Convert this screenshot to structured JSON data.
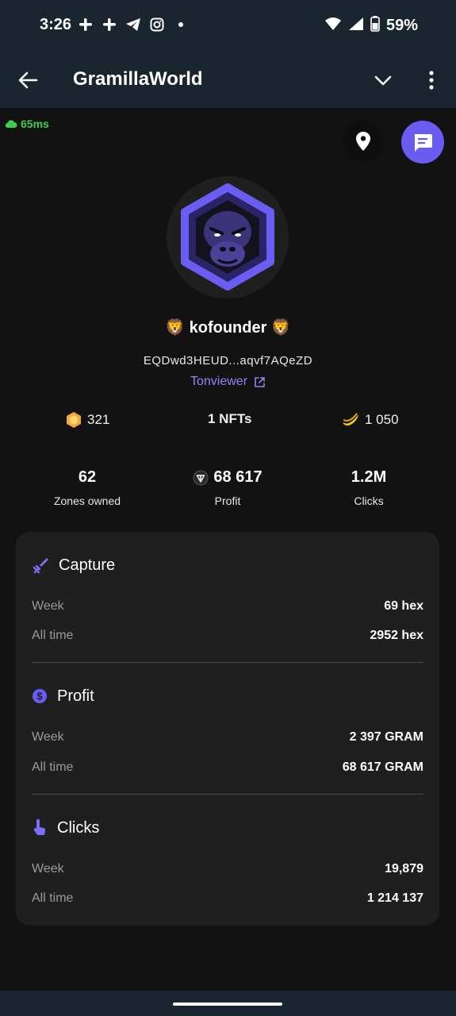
{
  "status_bar": {
    "time": "3:26",
    "left_icons": [
      "slack-icon",
      "slack-icon",
      "telegram-icon",
      "instagram-icon",
      "dot-icon"
    ],
    "battery": "59%"
  },
  "app_bar": {
    "title": "GramillaWorld"
  },
  "ping": "65ms",
  "profile": {
    "username": "🦁 kofounder 🦁",
    "wallet": "EQDwd3HEUD...aqvf7AQeZD",
    "explorer_link": "Tonviewer"
  },
  "tokens": {
    "coins": "321",
    "nfts": "1 NFTs",
    "bananas": "1 050"
  },
  "stats": {
    "zones_value": "62",
    "zones_label": "Zones owned",
    "profit_value": "68 617",
    "profit_label": "Profit",
    "clicks_value": "1.2M",
    "clicks_label": "Clicks"
  },
  "sections": {
    "capture": {
      "title": "Capture",
      "week_label": "Week",
      "week_value": "69 hex",
      "all_label": "All time",
      "all_value": "2952 hex"
    },
    "profit": {
      "title": "Profit",
      "week_label": "Week",
      "week_value": "2 397 GRAM",
      "all_label": "All time",
      "all_value": "68 617 GRAM"
    },
    "clicks": {
      "title": "Clicks",
      "week_label": "Week",
      "week_value": "19,879",
      "all_label": "All time",
      "all_value": "1 214 137"
    }
  },
  "colors": {
    "accent": "#6a5cf0",
    "link": "#8f86f5",
    "ping_green": "#3ccf4e",
    "bar_bg": "#1b2530",
    "card_bg": "#1f1f1f"
  }
}
